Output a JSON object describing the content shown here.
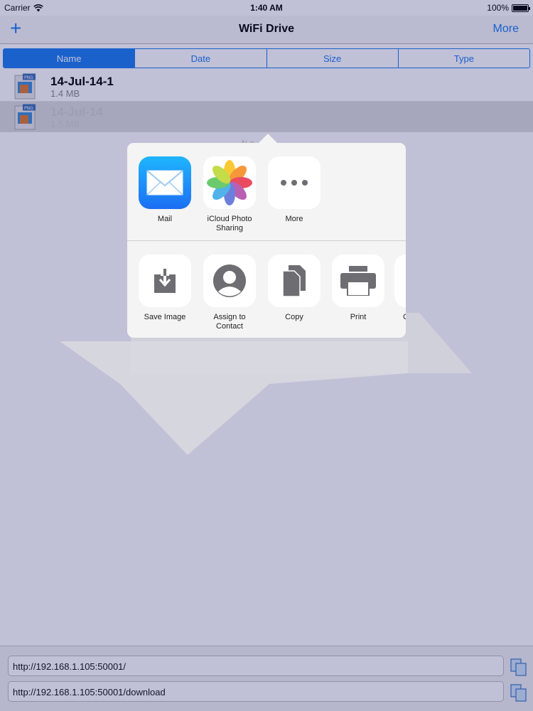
{
  "status_bar": {
    "carrier": "Carrier",
    "time": "1:40 AM",
    "battery": "100%"
  },
  "nav_bar": {
    "add_symbol": "+",
    "title": "WiFi Drive",
    "more_label": "More"
  },
  "sort_tabs": [
    {
      "label": "Name",
      "selected": true
    },
    {
      "label": "Date",
      "selected": false
    },
    {
      "label": "Size",
      "selected": false
    },
    {
      "label": "Type",
      "selected": false
    }
  ],
  "files": [
    {
      "name": "14-Jul-14-1",
      "size": "1.4 MB",
      "icon": "png-file-icon",
      "badge": "PNG"
    },
    {
      "name": "14-Jul-14",
      "size": "1.5 MB",
      "icon": "png-file-icon",
      "badge": "PNG"
    }
  ],
  "share_sheet": {
    "header_text": "N        g",
    "apps": [
      {
        "label": "Mail",
        "icon": "mail-icon"
      },
      {
        "label": "iCloud Photo Sharing",
        "icon": "photos-icon"
      },
      {
        "label": "More",
        "icon": "more-dots-icon"
      }
    ],
    "actions": [
      {
        "label": "Save Image",
        "icon": "save-image-icon"
      },
      {
        "label": "Assign to Contact",
        "icon": "contact-icon"
      },
      {
        "label": "Copy",
        "icon": "copy-icon"
      },
      {
        "label": "Print",
        "icon": "print-icon"
      },
      {
        "label": "C",
        "icon": "partial-action-icon"
      }
    ]
  },
  "bottom_bar": {
    "server_url": "http://192.168.1.105:50001/",
    "download_url": "http://192.168.1.105:50001/download"
  },
  "colors": {
    "accent": "#1a7cf0",
    "overlay": "#c0c0dc"
  }
}
